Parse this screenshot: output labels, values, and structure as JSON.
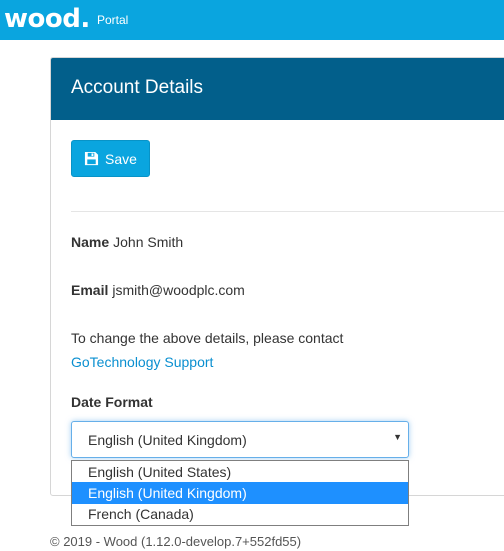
{
  "header": {
    "logo_text": "wood",
    "logo_dot": ".",
    "portal_label": "Portal",
    "brand_color": "#0aa5df"
  },
  "panel": {
    "title": "Account Details",
    "header_color": "#025f8b",
    "save_label": "Save",
    "save_icon": "floppy-disk-icon"
  },
  "account": {
    "name_label": "Name",
    "name_value": "John Smith",
    "email_label": "Email",
    "email_value": "jsmith@woodplc.com",
    "contact_text": "To change the above details, please contact",
    "support_link": "GoTechnology Support"
  },
  "date_format": {
    "label": "Date Format",
    "selected": "English (United Kingdom)",
    "options": [
      "English (United States)",
      "English (United Kingdom)",
      "French (Canada)"
    ],
    "highlight_color": "#1e90ff"
  },
  "footer": {
    "text": "© 2019 - Wood (1.12.0-develop.7+552fd55)"
  }
}
